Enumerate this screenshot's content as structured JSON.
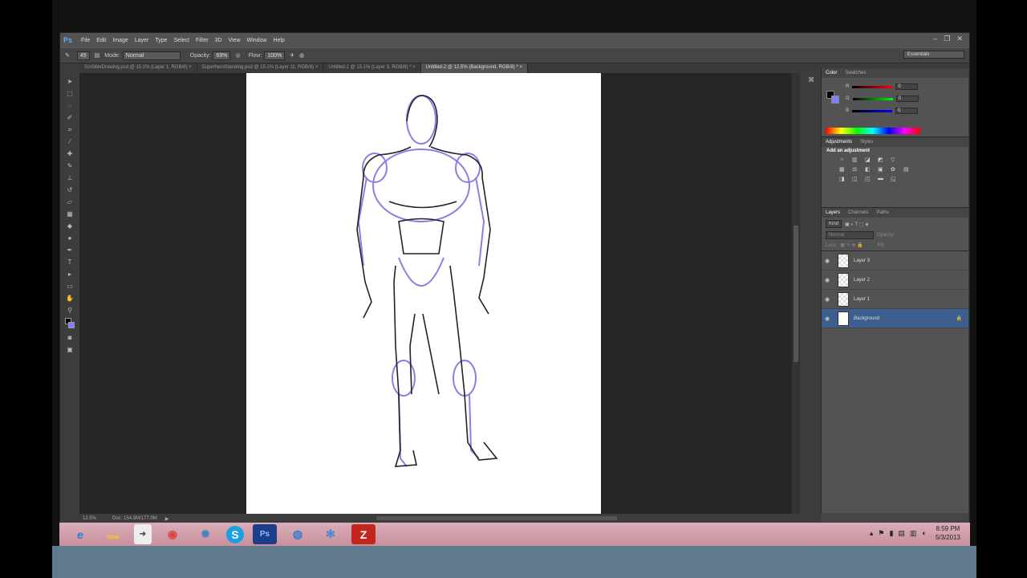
{
  "app": {
    "logo": "Ps",
    "min": "–",
    "restore": "❐",
    "close": "✕"
  },
  "menu": [
    "File",
    "Edit",
    "Image",
    "Layer",
    "Type",
    "Select",
    "Filter",
    "3D",
    "View",
    "Window",
    "Help"
  ],
  "options": {
    "mode_label": "Mode:",
    "mode_value": "Normal",
    "opacity_label": "Opacity:",
    "opacity_value": "69%",
    "flow_label": "Flow:",
    "flow_value": "100%",
    "brush_size": "45",
    "workspace": "Essentials"
  },
  "tabs": [
    "ScribbleDrawing.psd @ 15.1% (Layer 1, RGB/8) ×",
    "SuperheroStanding.psd @ 15.1% (Layer 11, RGB/8) ×",
    "Untitled-1 @ 15.1% (Layer 3, RGB/8) * ×",
    "Untitled-2 @ 12.5% (Background, RGB/8) * ×"
  ],
  "status": {
    "zoom": "12.5%",
    "doc": "Doc: 154.5M/177.0M"
  },
  "color_panel": {
    "tabs": [
      "Color",
      "Swatches"
    ],
    "r_label": "R",
    "g_label": "G",
    "b_label": "B",
    "r": "0",
    "g": "0",
    "b": "0",
    "fg": "#000000",
    "bg": "#8080ff"
  },
  "adjustments": {
    "tabs": [
      "Adjustments",
      "Styles"
    ],
    "title": "Add an adjustment"
  },
  "layers_panel": {
    "tabs": [
      "Layers",
      "Channels",
      "Paths"
    ],
    "kind": "Kind",
    "blend": "Normal",
    "opacity_label": "Opacity:",
    "lock_label": "Lock:",
    "fill_label": "Fill:",
    "layers": [
      {
        "name": "Layer 3"
      },
      {
        "name": "Layer 2"
      },
      {
        "name": "Layer 1"
      },
      {
        "name": "Background"
      }
    ]
  },
  "taskbar": {
    "apps": [
      {
        "name": "internet-explorer",
        "glyph": "e",
        "color": "#2a7fd4"
      },
      {
        "name": "file-explorer",
        "glyph": "▬",
        "color": "#e8b84a"
      },
      {
        "name": "app-arrow",
        "glyph": "➜",
        "color": "#555"
      },
      {
        "name": "chrome",
        "glyph": "◉",
        "color": "#d44"
      },
      {
        "name": "settings",
        "glyph": "✹",
        "color": "#4a7fc0"
      },
      {
        "name": "skype",
        "glyph": "S",
        "color": "#1ba0e1"
      },
      {
        "name": "photoshop",
        "glyph": "Ps",
        "color": "#1d3f8a"
      },
      {
        "name": "network-globe",
        "glyph": "◍",
        "color": "#3a7ac8"
      },
      {
        "name": "snowflake-app",
        "glyph": "✻",
        "color": "#3a8ad8"
      },
      {
        "name": "filezilla",
        "glyph": "Z",
        "color": "#c2261f"
      }
    ],
    "time": "8:59 PM",
    "date": "5/3/2013"
  }
}
